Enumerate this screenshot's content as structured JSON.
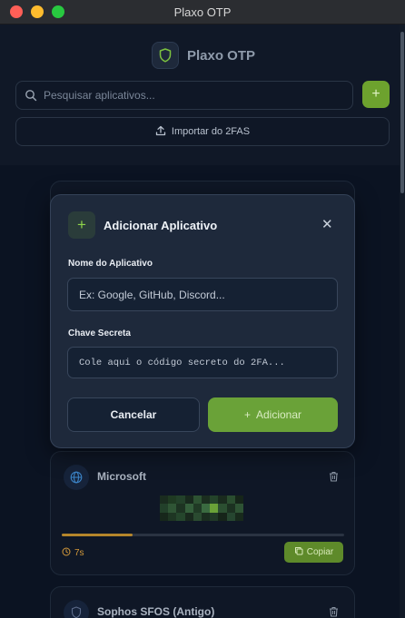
{
  "window": {
    "title": "Plaxo OTP"
  },
  "header": {
    "app_name": "Plaxo OTP",
    "search": {
      "placeholder": "Pesquisar aplicativos...",
      "value": ""
    },
    "import_label": "Importar do 2FAS"
  },
  "modal": {
    "title": "Adicionar Aplicativo",
    "name_label": "Nome do Aplicativo",
    "name_placeholder": "Ex: Google, GitHub, Discord...",
    "secret_label": "Chave Secreta",
    "secret_placeholder": "Cole aqui o código secreto do 2FA...",
    "cancel_label": "Cancelar",
    "add_label": "Adicionar"
  },
  "accounts": [
    {
      "name": "Microsoft",
      "icon": "globe-icon",
      "time_left": "7s",
      "progress": 0.25,
      "copy_label": "Copiar"
    },
    {
      "name": "Sophos SFOS (Antigo)",
      "icon": "shield-icon"
    }
  ],
  "colors": {
    "accent": "#6aa238",
    "timer": "#d59a3a",
    "background": "#0b1322"
  }
}
